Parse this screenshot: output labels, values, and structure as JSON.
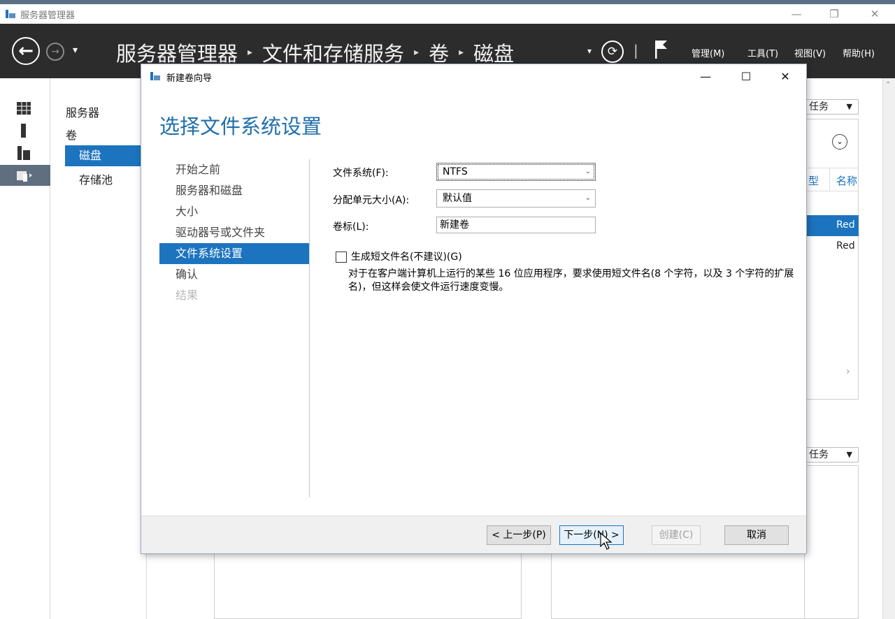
{
  "window": {
    "title": "服务器管理器",
    "minimize_label": "—",
    "restore_label": "❐",
    "close_label": "✕"
  },
  "header": {
    "breadcrumb": [
      "服务器管理器",
      "文件和存储服务",
      "卷",
      "磁盘"
    ],
    "menu": {
      "manage": "管理(M)",
      "tools": "工具(T)",
      "view": "视图(V)",
      "help": "帮助(H)"
    }
  },
  "subnav": {
    "items": [
      "服务器",
      "卷",
      "磁盘",
      "存储池"
    ]
  },
  "background_panel": {
    "tasks_label": "任务",
    "col_type": "型",
    "col_name": "名称",
    "row1_name": "Red",
    "row2_name": "Red",
    "tasks_label_2": "任务"
  },
  "dialog": {
    "title": "新建卷向导",
    "minimize_label": "—",
    "maximize_label": "☐",
    "close_label": "✕",
    "heading": "选择文件系统设置",
    "steps": [
      "开始之前",
      "服务器和磁盘",
      "大小",
      "驱动器号或文件夹",
      "文件系统设置",
      "确认",
      "结果"
    ],
    "form": {
      "filesystem_label": "文件系统(F):",
      "filesystem_value": "NTFS",
      "alloc_label": "分配单元大小(A):",
      "alloc_value": "默认值",
      "volume_label_label": "卷标(L):",
      "volume_label_value": "新建卷",
      "shortname_label": "生成短文件名(不建议)(G)",
      "shortname_checked": false,
      "description": "对于在客户端计算机上运行的某些 16 位应用程序，要求使用短文件名(8 个字符，以及 3 个字符的扩展名)，但这样会使文件运行速度变慢。"
    },
    "buttons": {
      "prev": "< 上一步(P)",
      "next": "下一步(N) >",
      "create": "创建(C)",
      "cancel": "取消"
    }
  },
  "colors": {
    "accent": "#1c74bf",
    "header_bg": "#2c2c2c",
    "heading_blue": "#1f6fab"
  }
}
